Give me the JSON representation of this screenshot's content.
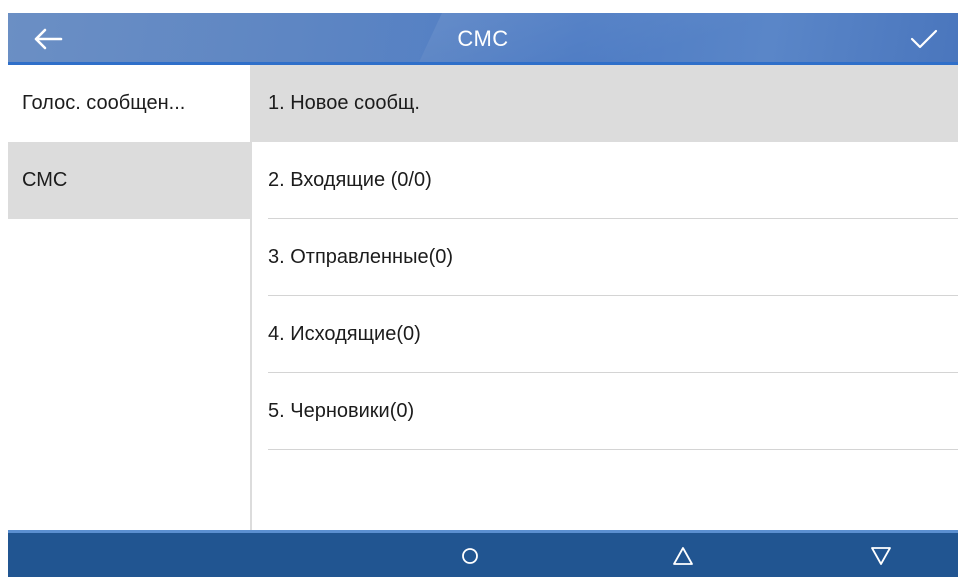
{
  "header": {
    "title": "СМС",
    "back_icon": "arrow-left-icon",
    "confirm_icon": "checkmark-icon",
    "colors": {
      "bar": "#5e86c3",
      "accent_line": "#2f6fc9"
    }
  },
  "sidebar": {
    "items": [
      {
        "label": "Голос. сообщен...",
        "active": false
      },
      {
        "label": "СМС",
        "active": true
      }
    ]
  },
  "menu": {
    "items": [
      {
        "label": "1.  Новое сообщ.",
        "selected": true
      },
      {
        "label": "2.  Входящие (0/0)",
        "selected": false
      },
      {
        "label": "3.  Отправленные(0)",
        "selected": false
      },
      {
        "label": "4.  Исходящие(0)",
        "selected": false
      },
      {
        "label": "5.  Черновики(0)",
        "selected": false
      }
    ]
  },
  "footer": {
    "keys": [
      "circle-icon",
      "triangle-up-icon",
      "triangle-down-icon"
    ],
    "colors": {
      "bar": "#215591",
      "top_line": "#5b8fd0"
    }
  }
}
